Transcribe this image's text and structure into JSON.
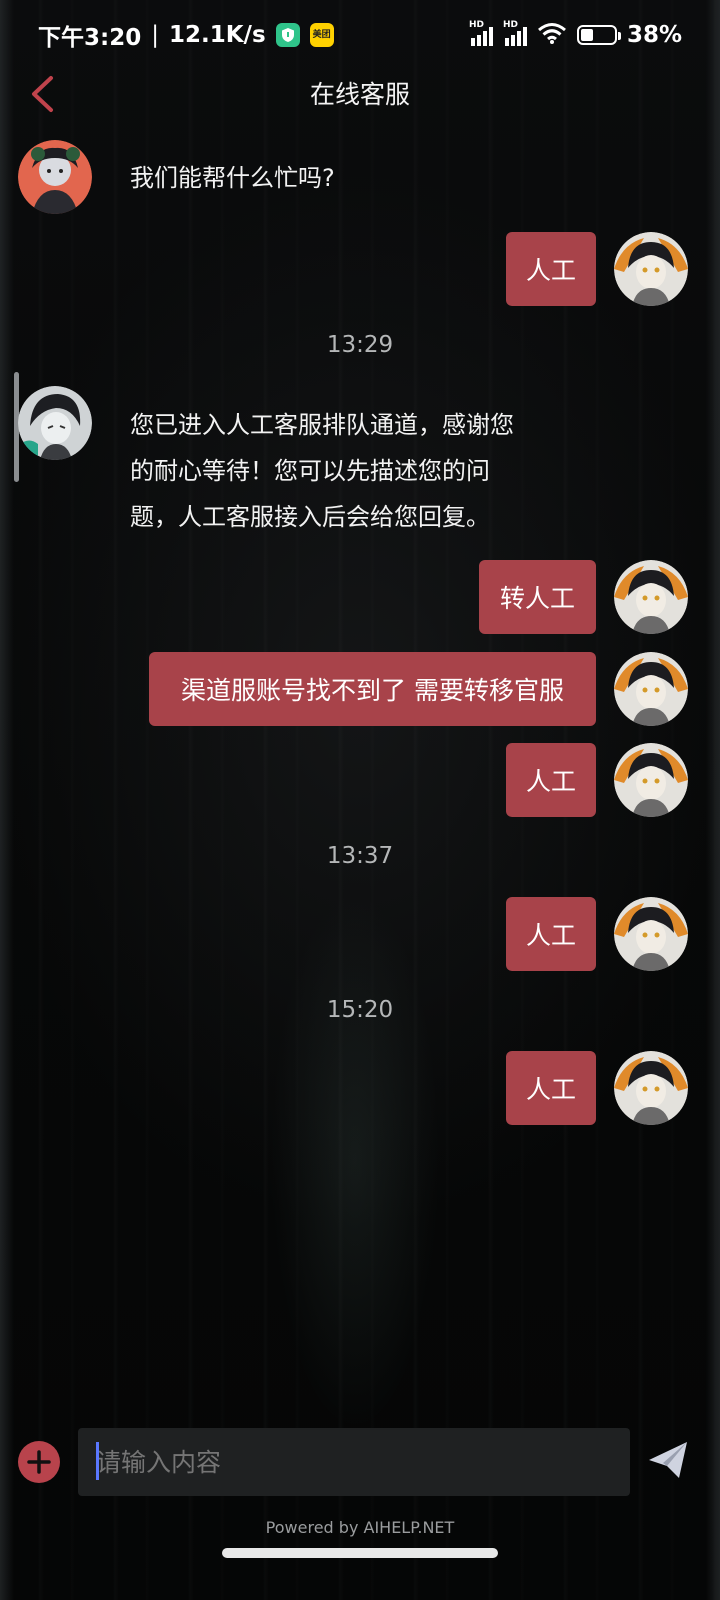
{
  "status_bar": {
    "time": "下午3:20",
    "net_speed": "12.1K/s",
    "battery_percent": "38%",
    "battery_level": 0.38
  },
  "header": {
    "title": "在线客服"
  },
  "messages": [
    {
      "side": "left",
      "text": "我们能帮什么忙吗?"
    },
    {
      "side": "right",
      "text": "人工"
    },
    {
      "type": "time",
      "text": "13:29"
    },
    {
      "side": "left",
      "lines": [
        "您已进入人工客服排队通道，感谢您",
        "的耐心等待！您可以先描述您的问",
        "题，人工客服接入后会给您回复。"
      ]
    },
    {
      "side": "right",
      "text": "转人工"
    },
    {
      "side": "right",
      "text": "渠道服账号找不到了 需要转移官服"
    },
    {
      "side": "right",
      "text": "人工"
    },
    {
      "type": "time",
      "text": "13:37"
    },
    {
      "side": "right",
      "text": "人工"
    },
    {
      "type": "time",
      "text": "15:20"
    },
    {
      "side": "right",
      "text": "人工"
    }
  ],
  "input": {
    "placeholder": "请输入内容"
  },
  "footer": {
    "powered_by": "Powered by AIHELP.NET"
  },
  "colors": {
    "accent": "#a8434a",
    "background": "#070808"
  }
}
